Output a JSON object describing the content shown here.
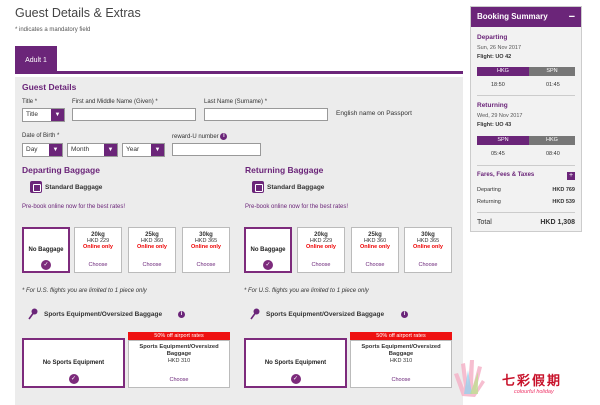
{
  "page": {
    "title": "Guest Details & Extras",
    "mandatory_note": "* indicates a mandatory field",
    "tab_label": "Adult 1"
  },
  "guest": {
    "section_title": "Guest Details",
    "title_label": "Title *",
    "title_value": "Title",
    "first_name_label": "First and Middle Name (Given) *",
    "last_name_label": "Last Name (Surname) *",
    "passport_note": "English name on Passport",
    "dob_label": "Date of Birth *",
    "day_value": "Day",
    "month_value": "Month",
    "year_value": "Year",
    "reward_label": "reward-U number",
    "info_icon": "i"
  },
  "departing_baggage": {
    "title": "Departing Baggage",
    "standard_label": "Standard Baggage",
    "promo": "Pre-book online now for the best rates!",
    "no_baggage": "No Baggage",
    "options": [
      {
        "weight": "20kg",
        "price": "HKD 229",
        "note": "Online only",
        "action": "Choose"
      },
      {
        "weight": "25kg",
        "price": "HKD 360",
        "note": "Online only",
        "action": "Choose"
      },
      {
        "weight": "30kg",
        "price": "HKD 365",
        "note": "Online only",
        "action": "Choose"
      }
    ],
    "us_note": "* For U.S. flights you are limited to 1 piece only",
    "sports_title": "Sports Equipment/Oversized Baggage",
    "no_sports": "No Sports Equipment",
    "sports_banner": "50% off airport rates",
    "sports_option_name": "Sports Equipment/Oversized Baggage",
    "sports_option_price": "HKD 310",
    "sports_action": "Choose"
  },
  "returning_baggage": {
    "title": "Returning Baggage",
    "standard_label": "Standard Baggage",
    "promo": "Pre-book online now for the best rates!",
    "no_baggage": "No Baggage",
    "options": [
      {
        "weight": "20kg",
        "price": "HKD 229",
        "note": "Online only",
        "action": "Choose"
      },
      {
        "weight": "25kg",
        "price": "HKD 360",
        "note": "Online only",
        "action": "Choose"
      },
      {
        "weight": "30kg",
        "price": "HKD 365",
        "note": "Online only",
        "action": "Choose"
      }
    ],
    "us_note": "* For U.S. flights you are limited to 1 piece only",
    "sports_title": "Sports Equipment/Oversized Baggage",
    "no_sports": "No Sports Equipment",
    "sports_banner": "50% off airport rates",
    "sports_option_name": "Sports Equipment/Oversized Baggage",
    "sports_option_price": "HKD 310",
    "sports_action": "Choose"
  },
  "summary": {
    "title": "Booking Summary",
    "collapse": "−",
    "departing": {
      "label": "Departing",
      "date": "Sun, 26 Nov 2017",
      "flight": "Flight: UO 42",
      "from": "HKG",
      "to": "SPN",
      "dep_time": "18:50",
      "arr_time": "01:45"
    },
    "returning": {
      "label": "Returning",
      "date": "Wed, 29 Nov 2017",
      "flight": "Flight: UO 43",
      "from": "SPN",
      "to": "HKG",
      "dep_time": "05:45",
      "arr_time": "08:40"
    },
    "fares_label": "Fares, Fees & Taxes",
    "expand": "+",
    "departing_row": "Departing",
    "departing_amount": "HKD 769",
    "returning_row": "Returning",
    "returning_amount": "HKD 539",
    "total_label": "Total",
    "total_amount": "HKD 1,308"
  },
  "watermark": {
    "brand_cn": "七彩假期",
    "brand_en": "colourful holiday"
  },
  "colors": {
    "accent": "#6b2579",
    "alert": "#e11111"
  }
}
